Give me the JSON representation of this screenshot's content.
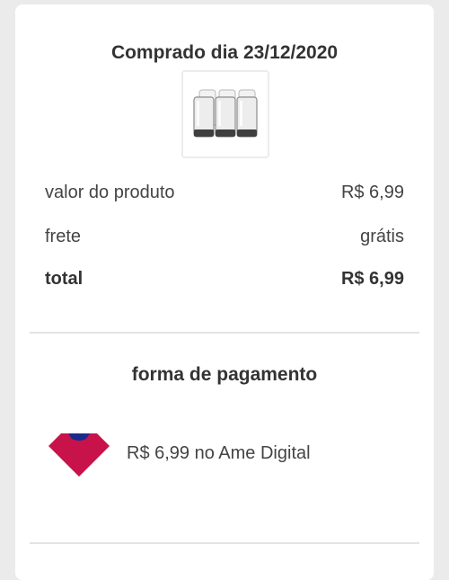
{
  "purchase": {
    "title": "Comprado dia 23/12/2020",
    "product_icon": "glass-set-product-image"
  },
  "summary": {
    "rows": [
      {
        "label": "valor do produto",
        "value": "R$ 6,99"
      },
      {
        "label": "frete",
        "value": "grátis"
      },
      {
        "label": "total",
        "value": "R$ 6,99"
      }
    ]
  },
  "payment": {
    "section_title": "forma de pagamento",
    "method_icon": "ame-digital-logo",
    "text": "R$ 6,99 no Ame Digital",
    "brand_colors": {
      "heart": "#c8124a",
      "accent": "#1a2a8c"
    }
  }
}
